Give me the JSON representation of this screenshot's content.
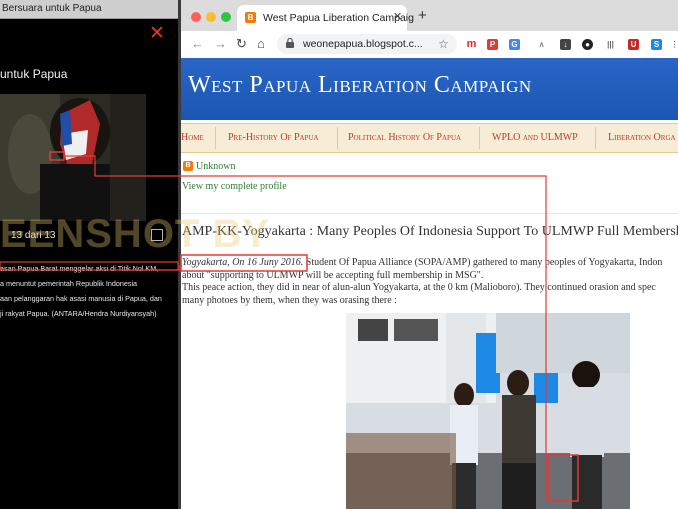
{
  "viewer": {
    "window_title": "Bersuara untuk Papua",
    "heading": "untuk Papua",
    "counter": "13 dari 13",
    "caption_lines": [
      "asan Papua Barat menggelar aksi di Titik Nol KM,",
      "a menuntut pemerintah Republik Indonesia",
      "aan pelanggaran hak asasi manusia di Papua, dan",
      "ji rakyat Papua. (ANTARA/Hendra Nurdiyansyah)"
    ]
  },
  "browser": {
    "tab_title": "West Papua Liberation Campaig",
    "url": "weonepapua.blogspot.c..."
  },
  "page": {
    "blog_title": "West Papua Liberation Campaign",
    "nav": [
      "Home",
      "Pre-History Of Papua",
      "Political History Of Papua",
      "WPLO and ULMWP",
      "Liberation Orga"
    ],
    "profile_name": "Unknown",
    "profile_link": "View my complete profile",
    "post_title": "AMP-KK-Yogyakarta : Many Peoples Of Indonesia Support To ULMWP Full Membership In M",
    "post_date": "Yogyakarta, On 16 Juny 2016.",
    "post_line1_rest": " Student Of Papua Alliance (SOPA/AMP) gathered to many peoples of Yogyakarta, Indon",
    "post_line2": "about \"supporting to ULMWP will be accepting full membership in MSG\".",
    "post_line3": "This peace action, they did in near of alun-alun Yogyakarta, at the 0 km (Malioboro). They continued orasion and spec",
    "post_line4": "many photoes by them, when they was orasing there :"
  },
  "watermark": "EENSHOT BY"
}
